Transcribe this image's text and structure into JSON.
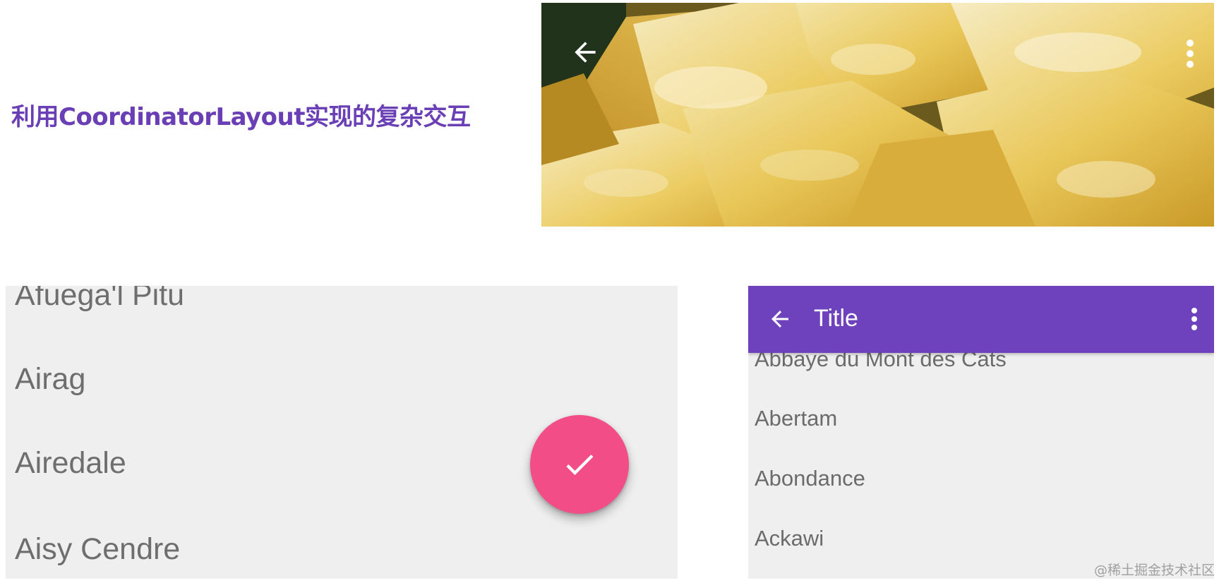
{
  "heading": "利用CoordinatorLayout实现的复杂交互",
  "hero": {
    "back_icon": "arrow-back-icon",
    "more_icon": "more-vert-icon",
    "image": "cheese-cubes-photo"
  },
  "left_list": {
    "items": [
      "Afuega'l Pitu",
      "Airag",
      "Airedale",
      "Aisy Cendre"
    ],
    "fab_icon": "check-icon"
  },
  "right_screen": {
    "toolbar_title": "Title",
    "back_icon": "arrow-back-icon",
    "more_icon": "more-vert-icon",
    "items": [
      "Abbaye du Mont des Cats",
      "Abertam",
      "Abondance",
      "Ackawi"
    ]
  },
  "colors": {
    "heading": "#6a3fb5",
    "toolbar": "#6f42bd",
    "fab": "#f34d87",
    "list_bg": "#efefef"
  },
  "watermark": "@稀土掘金技术社区"
}
